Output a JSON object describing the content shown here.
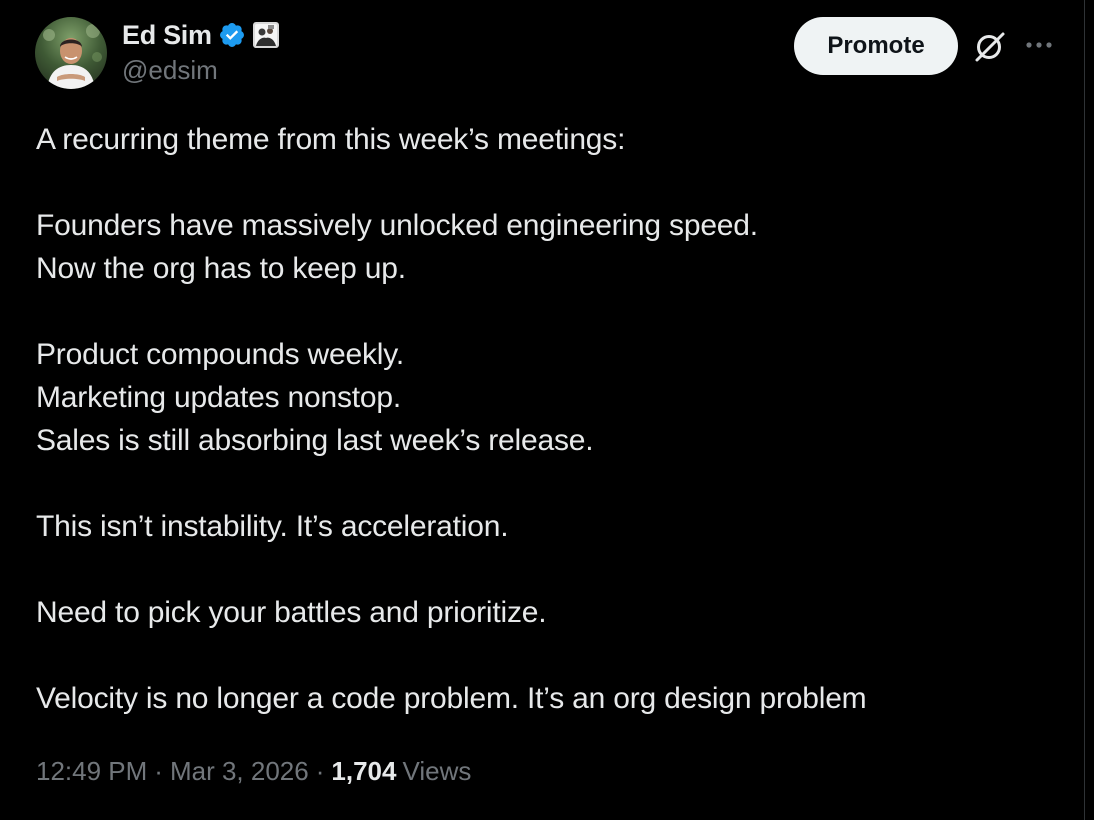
{
  "author": {
    "display_name": "Ed Sim",
    "handle": "@edsim",
    "verified": true,
    "avatar_icon": "profile-photo",
    "affiliate_icon": "affiliate-badge-icon"
  },
  "actions": {
    "promote_label": "Promote",
    "grok_icon": "grok-icon",
    "more_icon": "more-icon"
  },
  "tweet": {
    "lines": [
      "A recurring theme from this week’s meetings:",
      "",
      "Founders have massively unlocked engineering speed.",
      "Now the org has to keep up.",
      "",
      "Product compounds weekly.",
      "Marketing updates nonstop.",
      "Sales is still absorbing last week’s release.",
      "",
      "This isn’t instability. It’s acceleration.",
      "",
      "Need to pick your battles and prioritize.",
      "",
      "Velocity is no longer a code problem. It’s an org design problem"
    ]
  },
  "meta": {
    "time": "12:49 PM",
    "date": "Mar 3, 2026",
    "separator": "·",
    "views_count": "1,704",
    "views_label": "Views"
  },
  "colors": {
    "background": "#000000",
    "text_primary": "#e7e9ea",
    "text_secondary": "#71767b",
    "verified_blue": "#1d9bf0",
    "promote_bg": "#eff3f4"
  }
}
